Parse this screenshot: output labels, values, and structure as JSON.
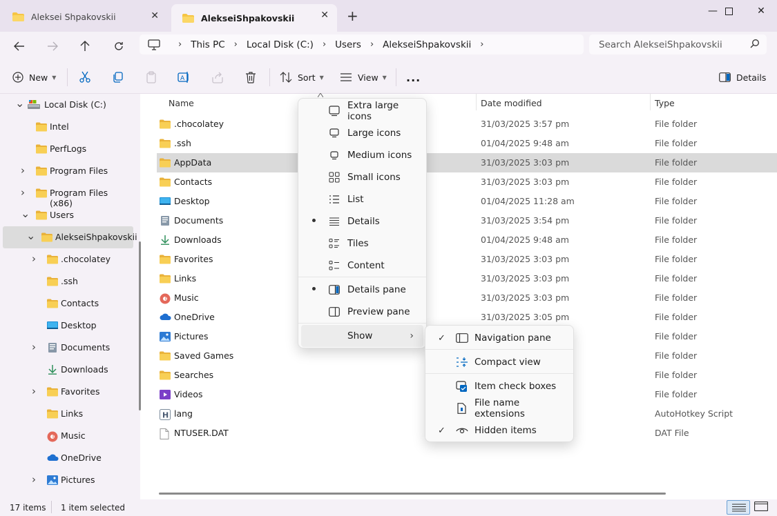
{
  "tabs": [
    {
      "label": "Aleksei Shpakovskii",
      "active": false
    },
    {
      "label": "AlekseiShpakovskii",
      "active": true
    }
  ],
  "window_controls": {
    "minimize": "—",
    "maximize": "☐",
    "close": "✕"
  },
  "address": {
    "segments": [
      "This PC",
      "Local Disk (C:)",
      "Users",
      "AlekseiShpakovskii"
    ]
  },
  "search": {
    "placeholder": "Search AlekseiShpakovskii"
  },
  "toolbar": {
    "new_label": "New",
    "sort_label": "Sort",
    "view_label": "View",
    "more_label": "...",
    "details_label": "Details"
  },
  "nav_tree": [
    {
      "label": "Local Disk (C:)",
      "icon": "drive-icon",
      "expander": "open"
    },
    {
      "label": "Intel",
      "icon": "folder-icon",
      "expander": "none"
    },
    {
      "label": "PerfLogs",
      "icon": "folder-icon",
      "expander": "none"
    },
    {
      "label": "Program Files",
      "icon": "folder-icon",
      "expander": "closed"
    },
    {
      "label": "Program Files (x86)",
      "icon": "folder-icon",
      "expander": "closed"
    },
    {
      "label": "Users",
      "icon": "folder-icon",
      "expander": "open"
    },
    {
      "label": "AlekseiShpakovskii",
      "icon": "folder-icon",
      "expander": "open",
      "selected": true
    },
    {
      "label": ".chocolatey",
      "icon": "folder-icon",
      "expander": "closed"
    },
    {
      "label": ".ssh",
      "icon": "folder-icon",
      "expander": "none"
    },
    {
      "label": "Contacts",
      "icon": "folder-icon",
      "expander": "none"
    },
    {
      "label": "Desktop",
      "icon": "desktop-icon",
      "expander": "none"
    },
    {
      "label": "Documents",
      "icon": "documents-icon",
      "expander": "closed"
    },
    {
      "label": "Downloads",
      "icon": "downloads-icon",
      "expander": "none"
    },
    {
      "label": "Favorites",
      "icon": "folder-icon",
      "expander": "closed"
    },
    {
      "label": "Links",
      "icon": "folder-icon",
      "expander": "none"
    },
    {
      "label": "Music",
      "icon": "music-icon",
      "expander": "none"
    },
    {
      "label": "OneDrive",
      "icon": "onedrive-icon",
      "expander": "none"
    },
    {
      "label": "Pictures",
      "icon": "pictures-icon",
      "expander": "closed"
    }
  ],
  "columns": {
    "name": "Name",
    "date": "Date modified",
    "type": "Type"
  },
  "files": [
    {
      "name": ".chocolatey",
      "date": "31/03/2025 3:57 pm",
      "type": "File folder",
      "icon": "folder-icon"
    },
    {
      "name": ".ssh",
      "date": "01/04/2025 9:48 am",
      "type": "File folder",
      "icon": "folder-icon"
    },
    {
      "name": "AppData",
      "date": "31/03/2025 3:03 pm",
      "type": "File folder",
      "icon": "folder-icon",
      "selected": true
    },
    {
      "name": "Contacts",
      "date": "31/03/2025 3:03 pm",
      "type": "File folder",
      "icon": "folder-icon"
    },
    {
      "name": "Desktop",
      "date": "01/04/2025 11:28 am",
      "type": "File folder",
      "icon": "desktop-icon"
    },
    {
      "name": "Documents",
      "date": "31/03/2025 3:54 pm",
      "type": "File folder",
      "icon": "documents-icon"
    },
    {
      "name": "Downloads",
      "date": "01/04/2025 9:48 am",
      "type": "File folder",
      "icon": "downloads-icon"
    },
    {
      "name": "Favorites",
      "date": "31/03/2025 3:03 pm",
      "type": "File folder",
      "icon": "folder-icon"
    },
    {
      "name": "Links",
      "date": "31/03/2025 3:03 pm",
      "type": "File folder",
      "icon": "folder-icon"
    },
    {
      "name": "Music",
      "date": "31/03/2025 3:03 pm",
      "type": "File folder",
      "icon": "music-icon"
    },
    {
      "name": "OneDrive",
      "date": "31/03/2025 3:05 pm",
      "type": "File folder",
      "icon": "onedrive-icon"
    },
    {
      "name": "Pictures",
      "date": "",
      "type": "File folder",
      "icon": "pictures-icon"
    },
    {
      "name": "Saved Games",
      "date": "",
      "type": "File folder",
      "icon": "folder-icon"
    },
    {
      "name": "Searches",
      "date": "",
      "type": "File folder",
      "icon": "folder-icon"
    },
    {
      "name": "Videos",
      "date": "",
      "type": "File folder",
      "icon": "videos-icon"
    },
    {
      "name": "lang",
      "date": "",
      "type": "AutoHotkey Script",
      "icon": "ahk-icon"
    },
    {
      "name": "NTUSER.DAT",
      "date": "",
      "type": "DAT File",
      "icon": "file-icon"
    }
  ],
  "view_menu": [
    {
      "label": "Extra large icons",
      "bullet": false
    },
    {
      "label": "Large icons",
      "bullet": false
    },
    {
      "label": "Medium icons",
      "bullet": false
    },
    {
      "label": "Small icons",
      "bullet": false
    },
    {
      "label": "List",
      "bullet": false
    },
    {
      "label": "Details",
      "bullet": true
    },
    {
      "label": "Tiles",
      "bullet": false
    },
    {
      "label": "Content",
      "bullet": false
    },
    {
      "label": "Details pane",
      "bullet": true
    },
    {
      "label": "Preview pane",
      "bullet": false
    },
    {
      "label": "Show",
      "submenu": true
    }
  ],
  "show_menu": [
    {
      "label": "Navigation pane",
      "checked": true
    },
    {
      "label": "Compact view",
      "checked": false
    },
    {
      "label": "Item check boxes",
      "checked": false
    },
    {
      "label": "File name extensions",
      "checked": false
    },
    {
      "label": "Hidden items",
      "checked": true
    }
  ],
  "status": {
    "count": "17 items",
    "selection": "1 item selected"
  },
  "colors": {
    "chrome": "#f5f1f7",
    "titlebar": "#e9e2ee",
    "folder": "#f6c544",
    "selection": "#dadada",
    "accent": "#0067c0"
  }
}
